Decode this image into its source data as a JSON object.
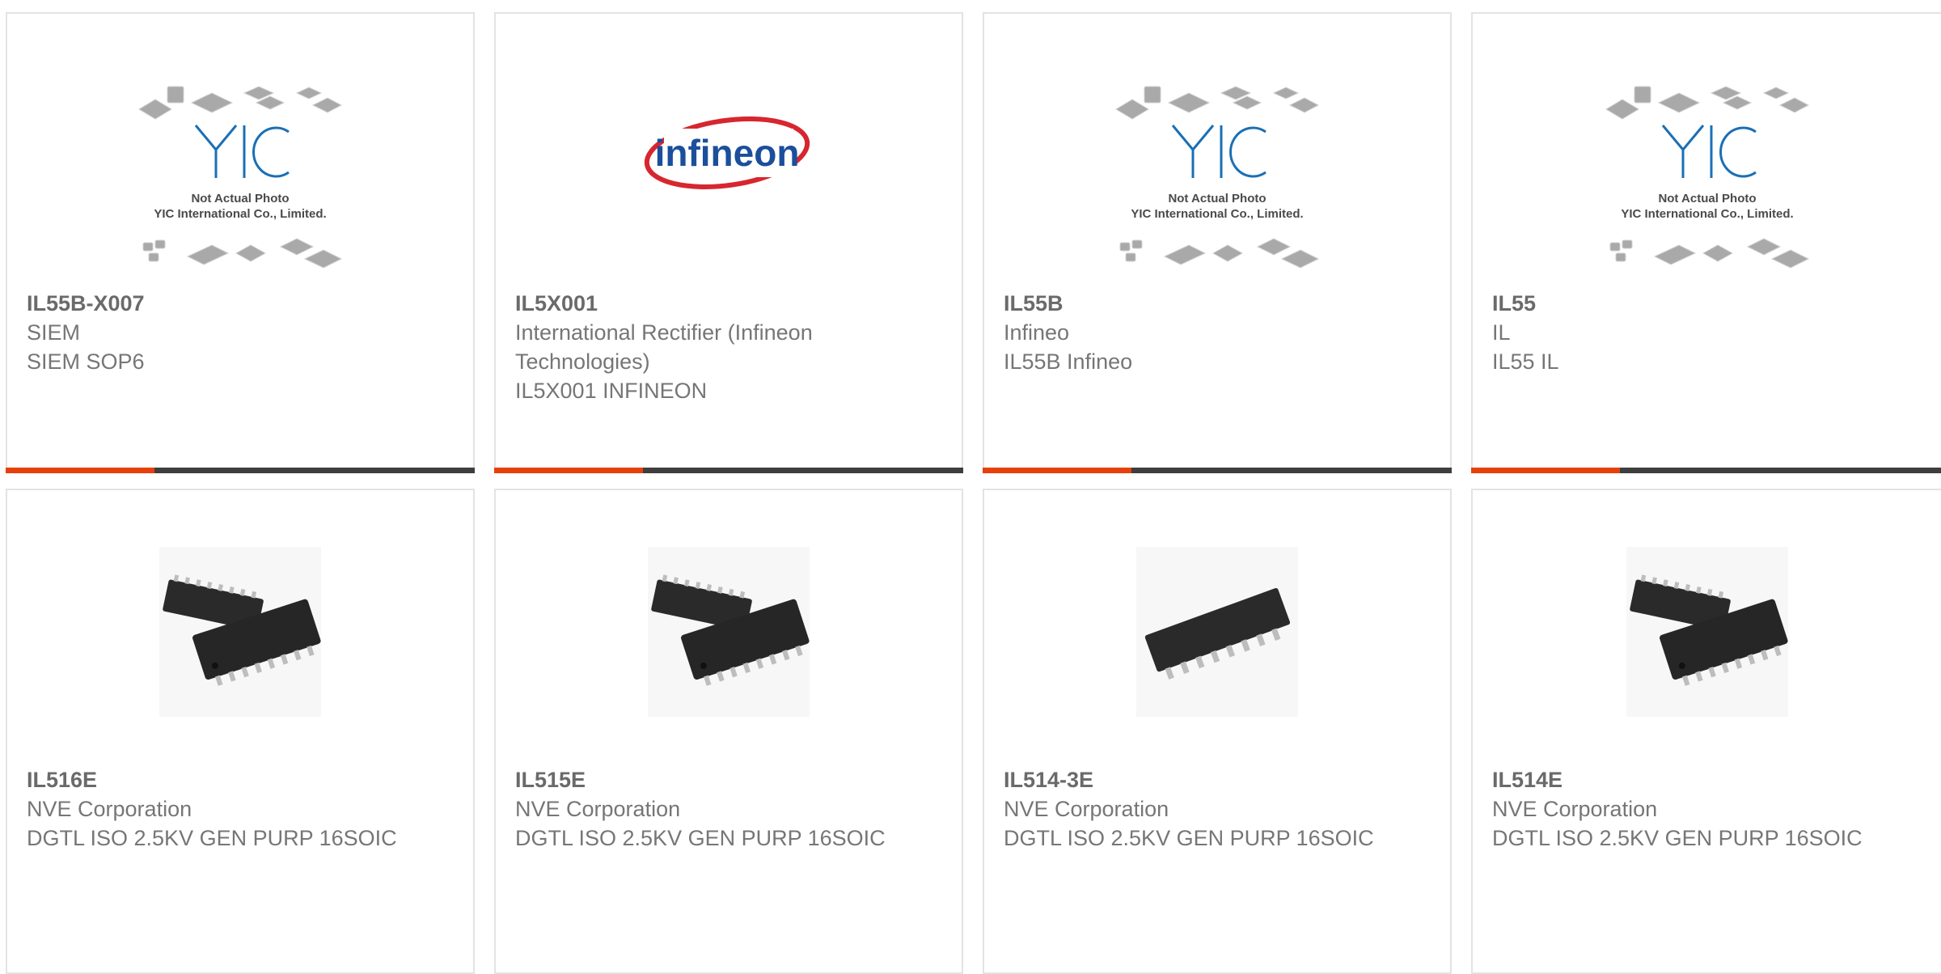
{
  "products": [
    {
      "part_number": "IL55B-X007",
      "manufacturer": "SIEM",
      "description": "SIEM SOP6",
      "image": "yic-placeholder-photo",
      "photo_note_1": "Not Actual Photo",
      "photo_note_2": "YIC International Co., Limited."
    },
    {
      "part_number": "IL5X001",
      "manufacturer": "International Rectifier (Infineon Technologies)",
      "description": "IL5X001 INFINEON",
      "image": "infineon-logo",
      "logo_text": "infineon"
    },
    {
      "part_number": "IL55B",
      "manufacturer": "Infineo",
      "description": "IL55B Infineo",
      "image": "yic-placeholder-photo",
      "photo_note_1": "Not Actual Photo",
      "photo_note_2": "YIC International Co., Limited."
    },
    {
      "part_number": "IL55",
      "manufacturer": "IL",
      "description": "IL55 IL",
      "image": "yic-placeholder-photo",
      "photo_note_1": "Not Actual Photo",
      "photo_note_2": "YIC International Co., Limited."
    },
    {
      "part_number": "IL516E",
      "manufacturer": "NVE Corporation",
      "description": "DGTL ISO 2.5KV GEN PURP 16SOIC",
      "image": "soic-16-chip-pair-photo"
    },
    {
      "part_number": "IL515E",
      "manufacturer": "NVE Corporation",
      "description": "DGTL ISO 2.5KV GEN PURP 16SOIC",
      "image": "soic-16-chip-pair-photo"
    },
    {
      "part_number": "IL514-3E",
      "manufacturer": "NVE Corporation",
      "description": "DGTL ISO 2.5KV GEN PURP 16SOIC",
      "image": "soic-16-single-chip-photo"
    },
    {
      "part_number": "IL514E",
      "manufacturer": "NVE Corporation",
      "description": "DGTL ISO 2.5KV GEN PURP 16SOIC",
      "image": "soic-16-chip-pair-photo"
    }
  ],
  "colors": {
    "accent": "#e8400c",
    "bar": "#3e3e3e",
    "border": "#e3e3e3",
    "text": "#767676",
    "yic_blue": "#1a6fb5"
  }
}
